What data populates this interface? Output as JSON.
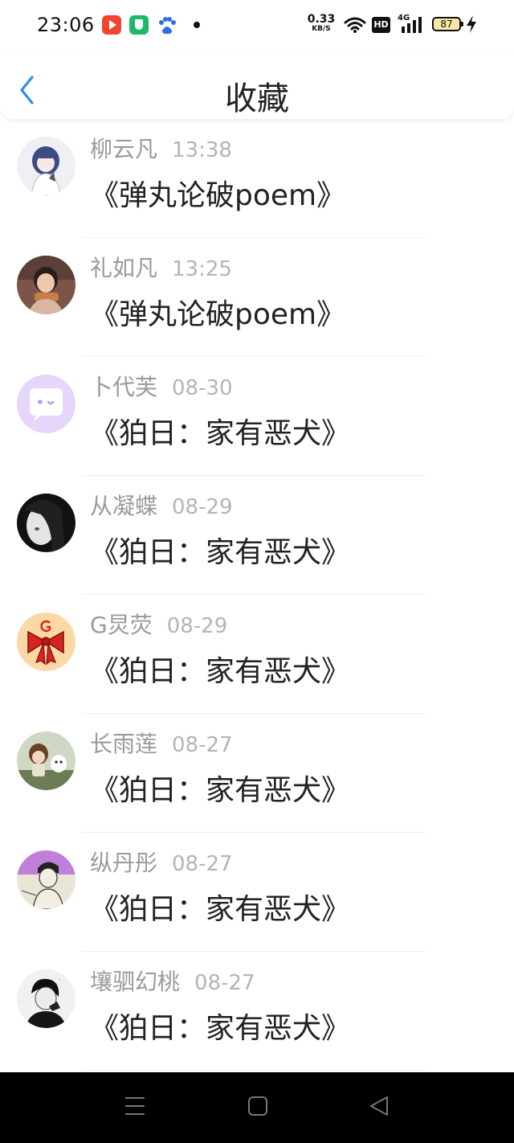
{
  "status_bar": {
    "time": "23:06",
    "net_speed_value": "0.33",
    "net_speed_unit": "KB/S",
    "hd_label": "HD",
    "signal_label": "4G",
    "battery_level": "87",
    "notification_icons": [
      "video-app-icon",
      "shield-app-icon",
      "baidu-app-icon"
    ]
  },
  "header": {
    "title": "收藏",
    "back_icon": "chevron-left-icon",
    "accent_color": "#2f8fe6"
  },
  "favorites": [
    {
      "user": "柳云凡",
      "time": "13:38",
      "title": "《弹丸论破poem》",
      "avatar": "anime-girl-avatar"
    },
    {
      "user": "礼如凡",
      "time": "13:25",
      "title": "《弹丸论破poem》",
      "avatar": "child-photo-avatar"
    },
    {
      "user": "卜代芙",
      "time": "08-30",
      "title": "《狛日：家有恶犬》",
      "avatar": "purple-chat-avatar"
    },
    {
      "user": "从凝蝶",
      "time": "08-29",
      "title": "《狛日：家有恶犬》",
      "avatar": "bw-portrait-avatar"
    },
    {
      "user": "G炅荧",
      "time": "08-29",
      "title": "《狛日：家有恶犬》",
      "avatar": "red-bow-avatar"
    },
    {
      "user": "长雨莲",
      "time": "08-27",
      "title": "《狛日：家有恶犬》",
      "avatar": "figurine-avatar"
    },
    {
      "user": "纵丹彤",
      "time": "08-27",
      "title": "《狛日：家有恶犬》",
      "avatar": "sketch-boy-avatar"
    },
    {
      "user": "壤驷幻桃",
      "time": "08-27",
      "title": "《狛日：家有恶犬》",
      "avatar": "bw-boy-avatar"
    }
  ],
  "nav_bar": {
    "buttons": [
      "menu-icon",
      "home-square-icon",
      "back-triangle-icon"
    ]
  }
}
